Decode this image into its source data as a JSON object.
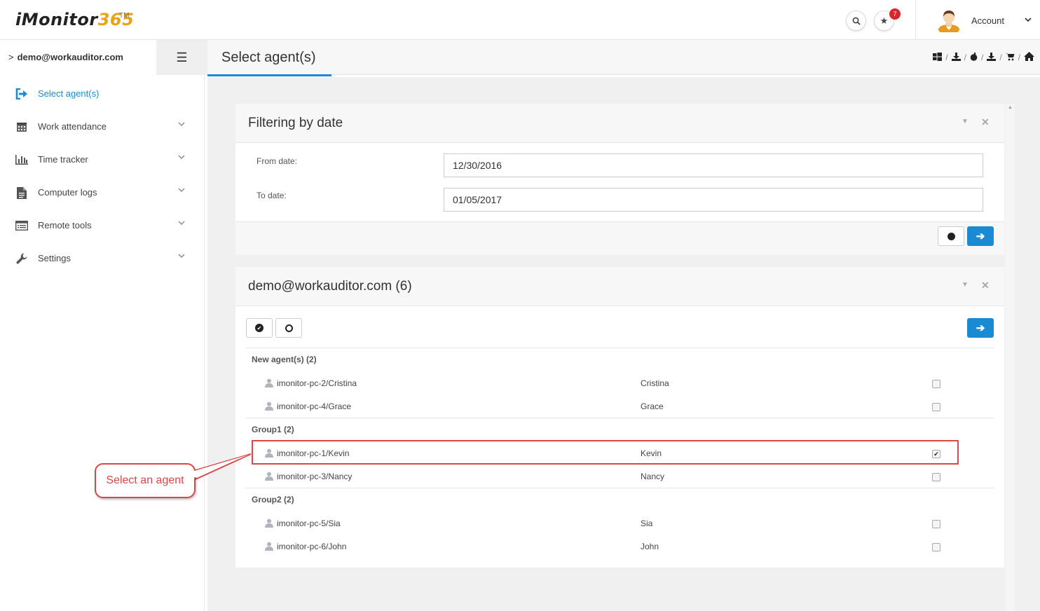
{
  "header": {
    "logo_text": "iMonitor",
    "logo_num": "365",
    "logo_tm": "TM",
    "notification_count": "7",
    "account_label": "Account"
  },
  "subbar": {
    "user": "demo@workauditor.com",
    "page_title": "Select agent(s)"
  },
  "sidebar": {
    "items": [
      {
        "label": "Select agent(s)",
        "icon": "sign-in-icon"
      },
      {
        "label": "Work attendance",
        "icon": "calendar-icon"
      },
      {
        "label": "Time tracker",
        "icon": "bar-chart-icon"
      },
      {
        "label": "Computer logs",
        "icon": "document-icon"
      },
      {
        "label": "Remote tools",
        "icon": "list-icon"
      },
      {
        "label": "Settings",
        "icon": "wrench-icon"
      }
    ]
  },
  "filter_panel": {
    "title": "Filtering by date",
    "from_label": "From date:",
    "from_value": "12/30/2016",
    "to_label": "To date:",
    "to_value": "01/05/2017"
  },
  "agents_panel": {
    "title": "demo@workauditor.com (6)",
    "groups": [
      {
        "label": "New agent(s) (2)",
        "agents": [
          {
            "name": "imonitor-pc-2/Cristina",
            "user": "Cristina",
            "checked": false
          },
          {
            "name": "imonitor-pc-4/Grace",
            "user": "Grace",
            "checked": false
          }
        ]
      },
      {
        "label": "Group1 (2)",
        "agents": [
          {
            "name": "imonitor-pc-1/Kevin",
            "user": "Kevin",
            "checked": true
          },
          {
            "name": "imonitor-pc-3/Nancy",
            "user": "Nancy",
            "checked": false
          }
        ]
      },
      {
        "label": "Group2 (2)",
        "agents": [
          {
            "name": "imonitor-pc-5/Sia",
            "user": "Sia",
            "checked": false
          },
          {
            "name": "imonitor-pc-6/John",
            "user": "John",
            "checked": false
          }
        ]
      }
    ]
  },
  "annotation": {
    "callout": "Select an agent"
  },
  "colors": {
    "accent": "#1a8ad2",
    "annotation": "#d9474a",
    "badge": "#d9262c"
  }
}
